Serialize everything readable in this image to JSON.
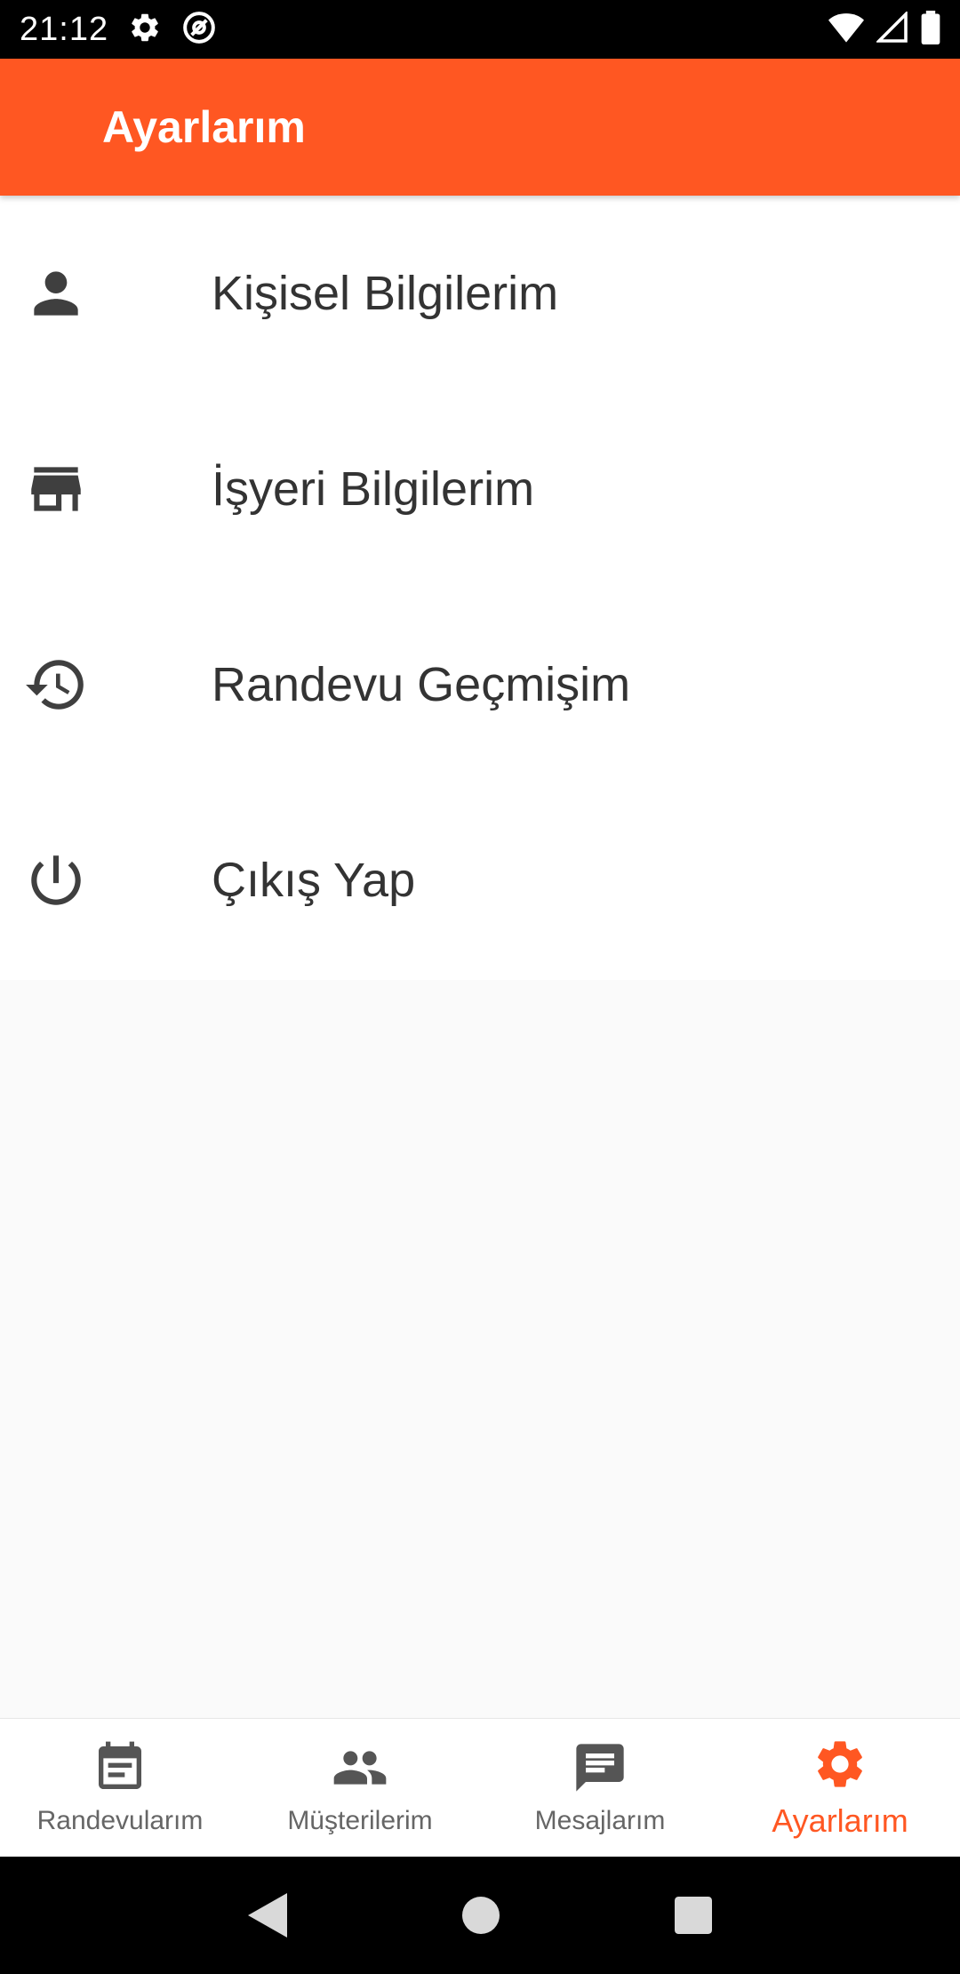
{
  "status_bar": {
    "time": "21:12",
    "icons": [
      "gear-icon",
      "at-sign-icon",
      "wifi-icon",
      "signal-icon",
      "battery-icon"
    ]
  },
  "app_bar": {
    "title": "Ayarlarım",
    "color": "#FF5722"
  },
  "menu": {
    "items": [
      {
        "label": "Kişisel Bilgilerim",
        "icon": "person-icon"
      },
      {
        "label": "İşyeri Bilgilerim",
        "icon": "store-icon"
      },
      {
        "label": "Randevu Geçmişim",
        "icon": "history-icon"
      },
      {
        "label": "Çıkış Yap",
        "icon": "power-icon"
      }
    ]
  },
  "bottom_nav": {
    "items": [
      {
        "label": "Randevularım",
        "icon": "calendar-icon",
        "active": false
      },
      {
        "label": "Müşterilerim",
        "icon": "people-icon",
        "active": false
      },
      {
        "label": "Mesajlarım",
        "icon": "message-icon",
        "active": false
      },
      {
        "label": "Ayarlarım",
        "icon": "settings-icon",
        "active": true
      }
    ],
    "active_color": "#FF5722"
  },
  "system_nav": {
    "icons": [
      "back-icon",
      "home-icon",
      "recents-icon"
    ]
  }
}
